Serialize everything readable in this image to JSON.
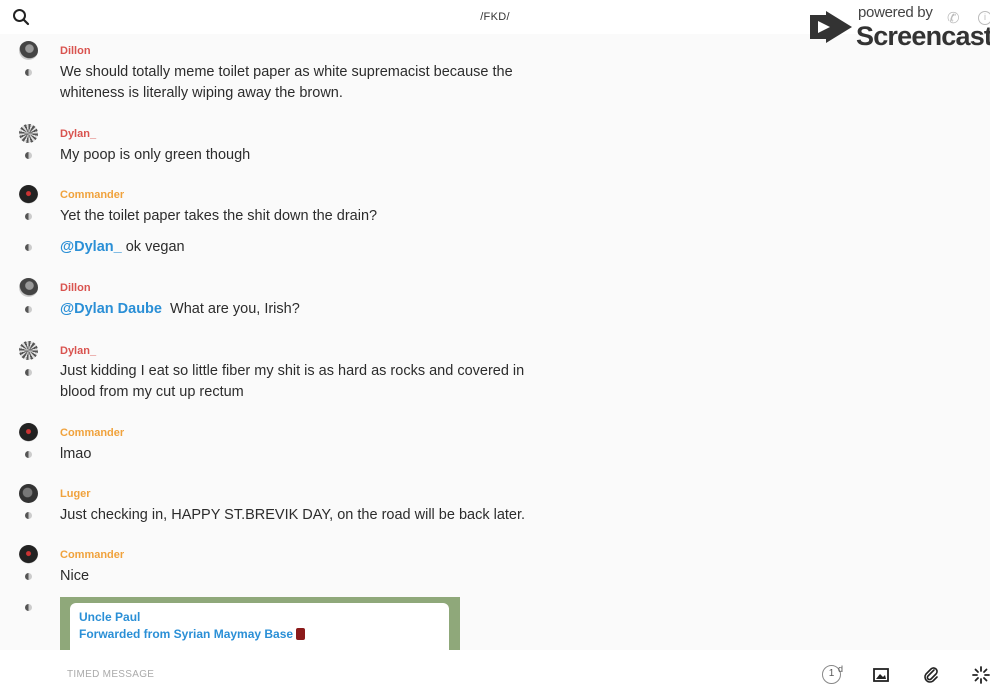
{
  "header": {
    "title": "/FKD/"
  },
  "watermark": {
    "line1": "powered by",
    "line2": "Screencastify"
  },
  "messages": [
    {
      "name": "Dillon",
      "text": "We should totally meme toilet paper as white supremacist because the whiteness is literally wiping away the brown."
    },
    {
      "name": "Dylan_",
      "text": "My poop is only green though"
    },
    {
      "name": "Commander",
      "text": "Yet the toilet paper takes the shit down the drain?"
    },
    {
      "mention": "@Dylan_",
      "text": " ok vegan"
    },
    {
      "name": "Dillon",
      "mention": "@Dylan Daube",
      "text": "  What are you, Irish?"
    },
    {
      "name": "Dylan_",
      "text": "Just kidding I eat so little fiber my shit is as hard as rocks and covered in blood from my cut up rectum"
    },
    {
      "name": "Commander",
      "text": "lmao"
    },
    {
      "name": "Luger",
      "text": "Just checking in, HAPPY ST.BREVIK DAY, on the road will be back later."
    },
    {
      "name": "Commander",
      "text": "Nice"
    }
  ],
  "forward": {
    "name": "Uncle Paul",
    "from": "Forwarded from Syrian Maymay Base"
  },
  "composer": {
    "placeholder": "TIMED MESSAGE",
    "timer_value": "1",
    "timer_unit": "d"
  },
  "colors": {
    "name_red": "#d9534f",
    "name_orange": "#f0a23c",
    "mention_blue": "#2a8fd6"
  },
  "icons": [
    "search-icon",
    "phone-icon",
    "info-icon",
    "timer-icon",
    "image-icon",
    "paperclip-icon",
    "sparkle-icon"
  ]
}
